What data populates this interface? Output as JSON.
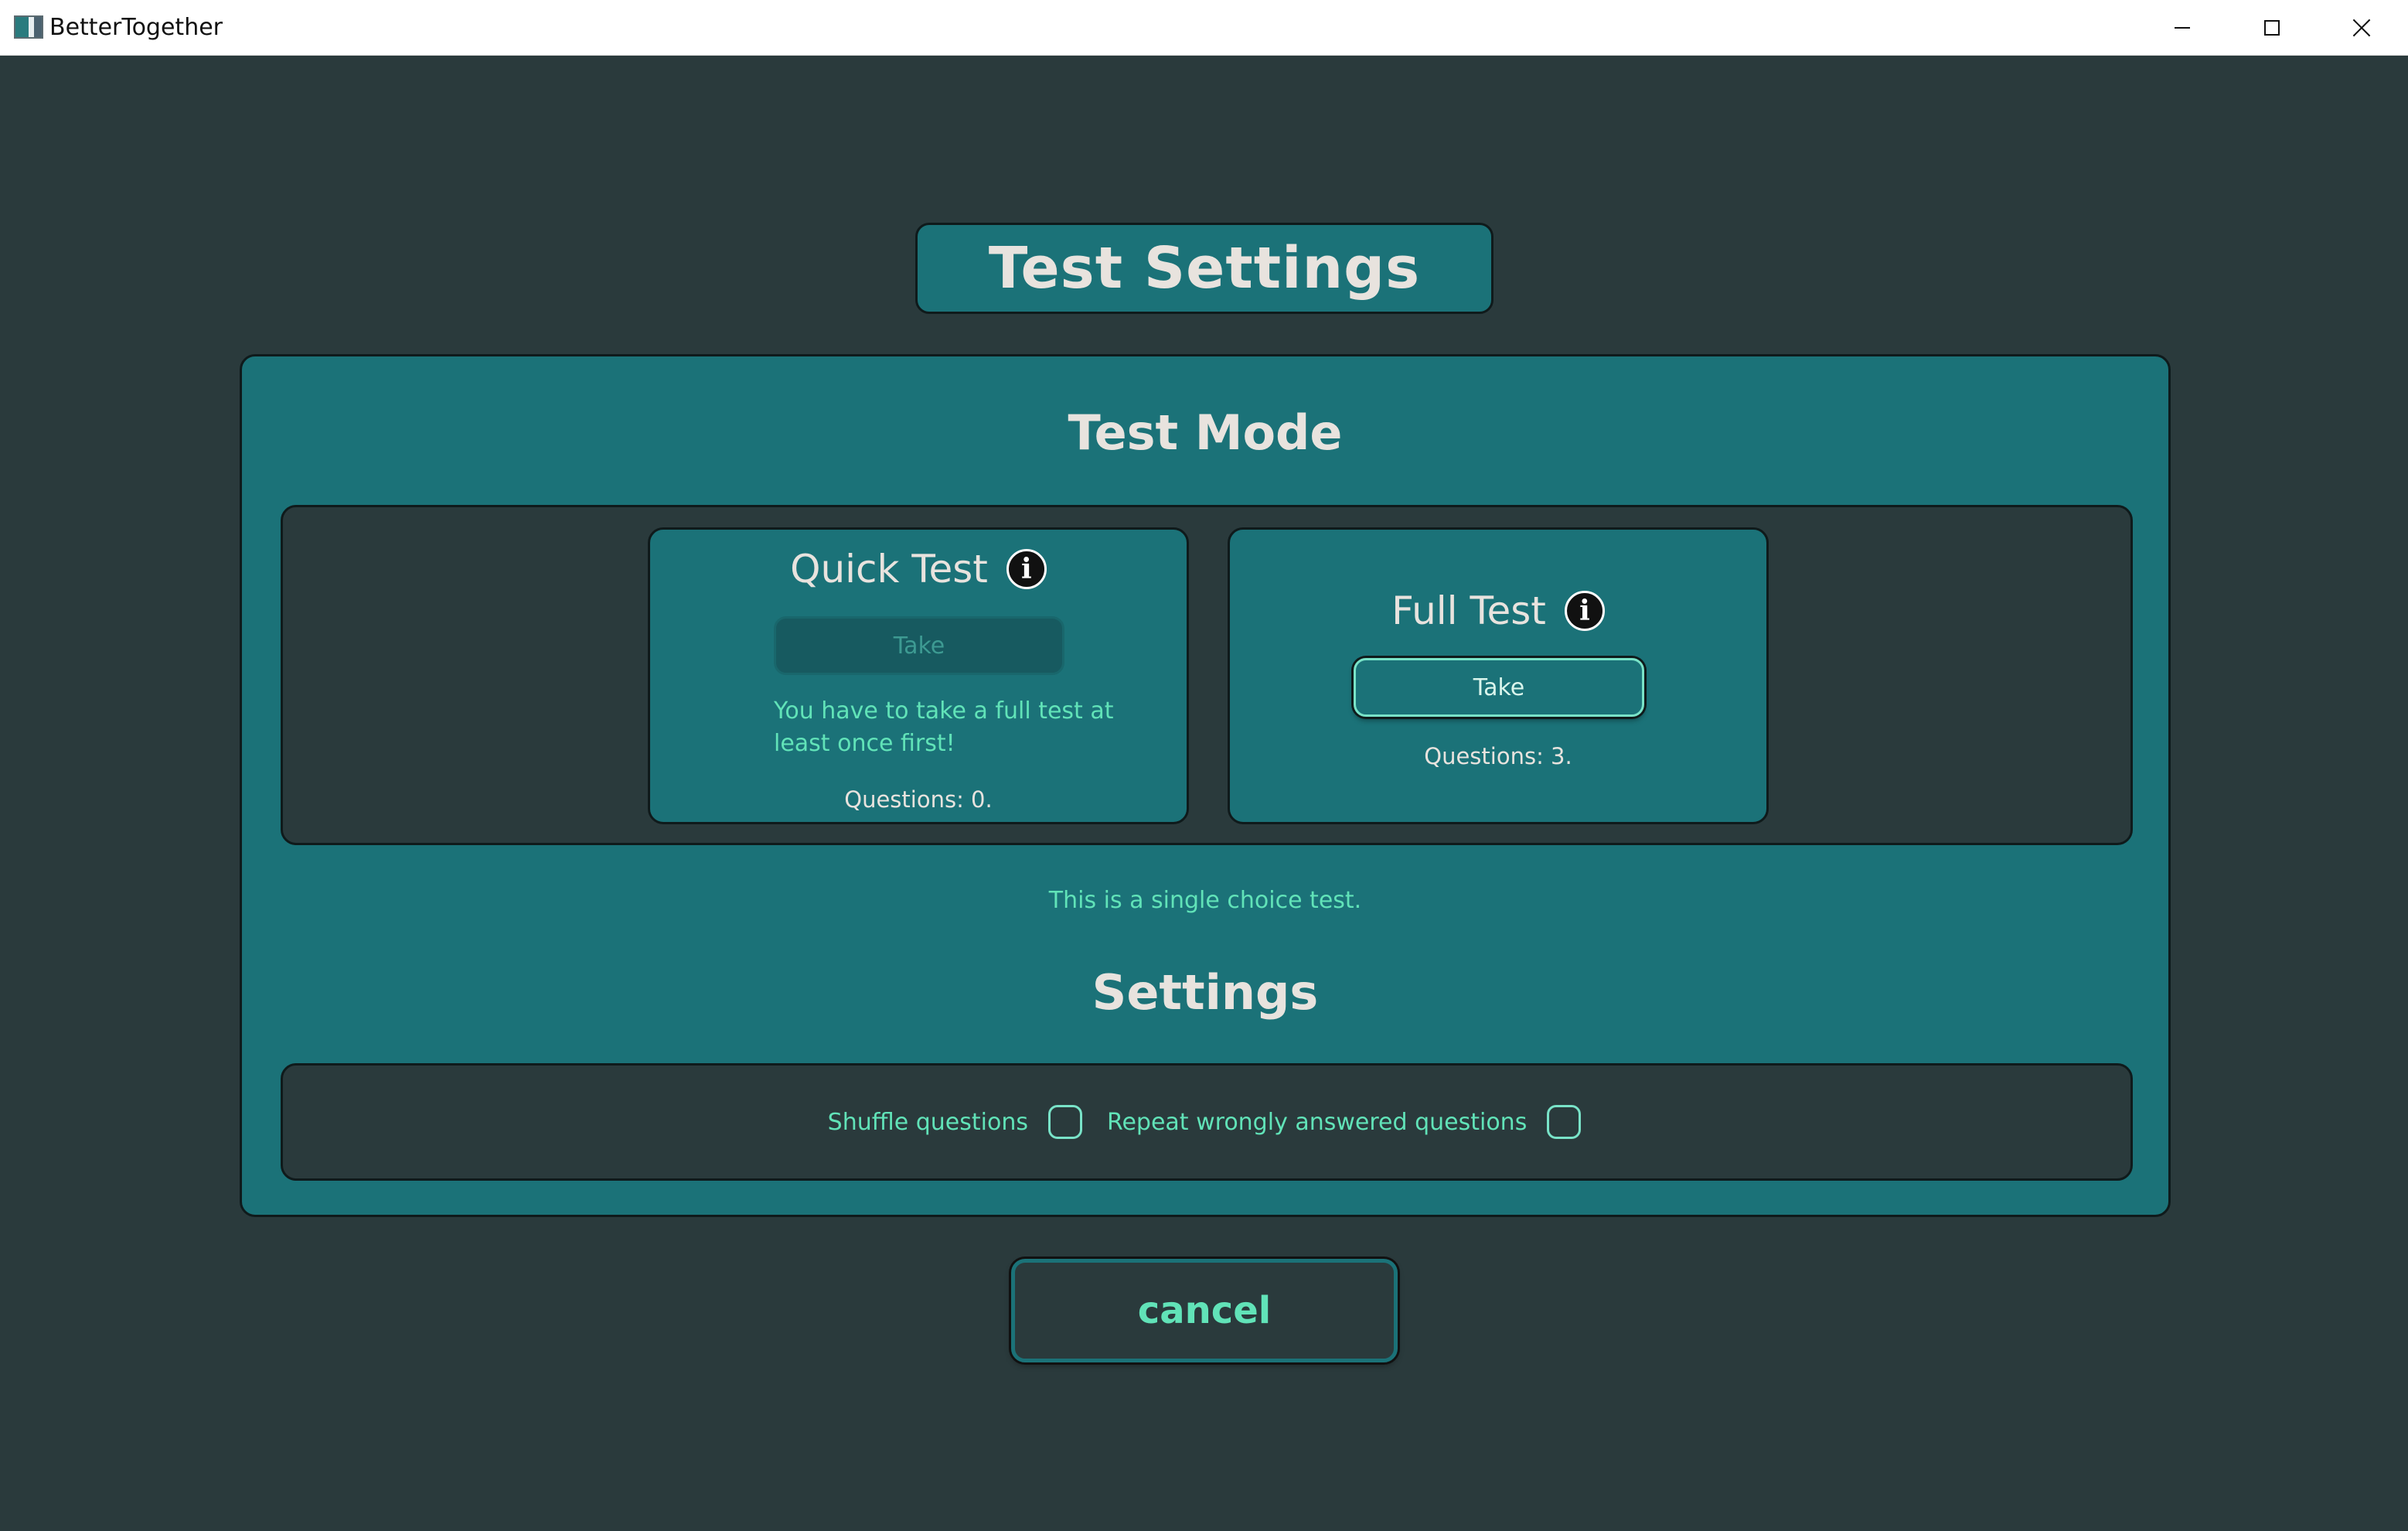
{
  "window": {
    "title": "BetterTogether"
  },
  "header": {
    "title": "Test Settings"
  },
  "test_mode": {
    "heading": "Test Mode",
    "quick_test": {
      "title": "Quick Test",
      "button_label": "Take",
      "button_state": "disabled",
      "warning": "You have to take a full test at least once first!",
      "questions": "Questions: 0."
    },
    "full_test": {
      "title": "Full Test",
      "button_label": "Take",
      "button_state": "enabled",
      "questions": "Questions: 3."
    },
    "description": "This is a single choice test."
  },
  "settings": {
    "heading": "Settings",
    "shuffle_label": "Shuffle questions",
    "shuffle_checked": false,
    "repeat_label": "Repeat wrongly answered questions",
    "repeat_checked": false
  },
  "footer": {
    "cancel_label": "cancel"
  },
  "colors": {
    "background": "#2a3a3c",
    "panel": "#1b7278",
    "accent": "#61e3b8",
    "heading_text": "#e8e3de"
  },
  "icons": {
    "app": "app-icon",
    "info": "info-icon",
    "minimize": "minimize-icon",
    "maximize": "maximize-icon",
    "close": "close-icon"
  }
}
